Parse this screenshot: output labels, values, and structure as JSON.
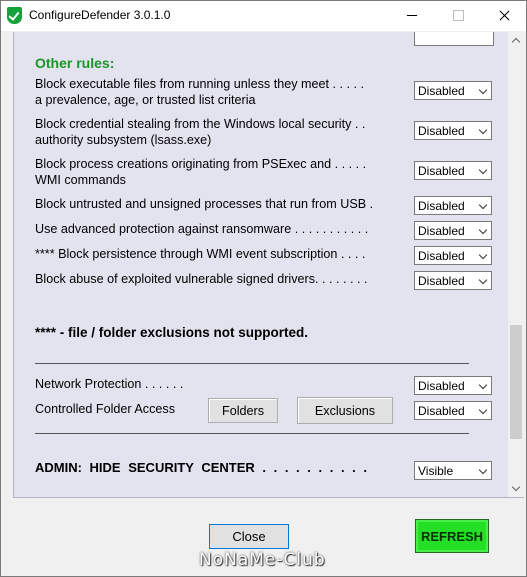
{
  "window": {
    "title": "ConfigureDefender 3.0.1.0"
  },
  "section": {
    "heading": "Other rules:"
  },
  "rules": [
    {
      "line1": "Block executable files from running unless they meet . . . . .",
      "line2": "a prevalence, age, or trusted list criteria",
      "value": "Disabled"
    },
    {
      "line1": "Block credential stealing from the Windows local security . .",
      "line2": "authority subsystem (lsass.exe)",
      "value": "Disabled"
    },
    {
      "line1": "Block process creations originating from PSExec and . . . . .",
      "line2": "WMI commands",
      "value": "Disabled"
    },
    {
      "line1": "Block untrusted and unsigned processes that run from USB .",
      "value": "Disabled"
    },
    {
      "line1": "Use advanced protection against ransomware . . . . . . . . . . .",
      "value": "Disabled"
    },
    {
      "line1": "**** Block persistence through WMI event subscription . . . .",
      "value": "Disabled"
    },
    {
      "line1": "Block abuse of exploited vulnerable signed drivers. . . . . . . .",
      "value": "Disabled"
    }
  ],
  "note": "**** - file / folder exclusions not supported.",
  "network": {
    "label": "Network Protection . . . . . . . . . . . . . . . . . . . . . . . . . . . . . . . . .",
    "value": "Disabled"
  },
  "cfa": {
    "label": "Controlled Folder Access",
    "folders_label": "Folders",
    "exclusions_label": "Exclusions",
    "value": "Disabled"
  },
  "admin": {
    "label": "ADMIN: HIDE SECURITY CENTER . . . . . . . . . .",
    "value": "Visible"
  },
  "buttons": {
    "close": "Close",
    "refresh": "REFRESH"
  },
  "watermark": "NoNaMe-Club",
  "colors": {
    "heading": "#1a9628",
    "refresh_bg": "#24e024",
    "panel_bg": "#e3e3f0"
  }
}
